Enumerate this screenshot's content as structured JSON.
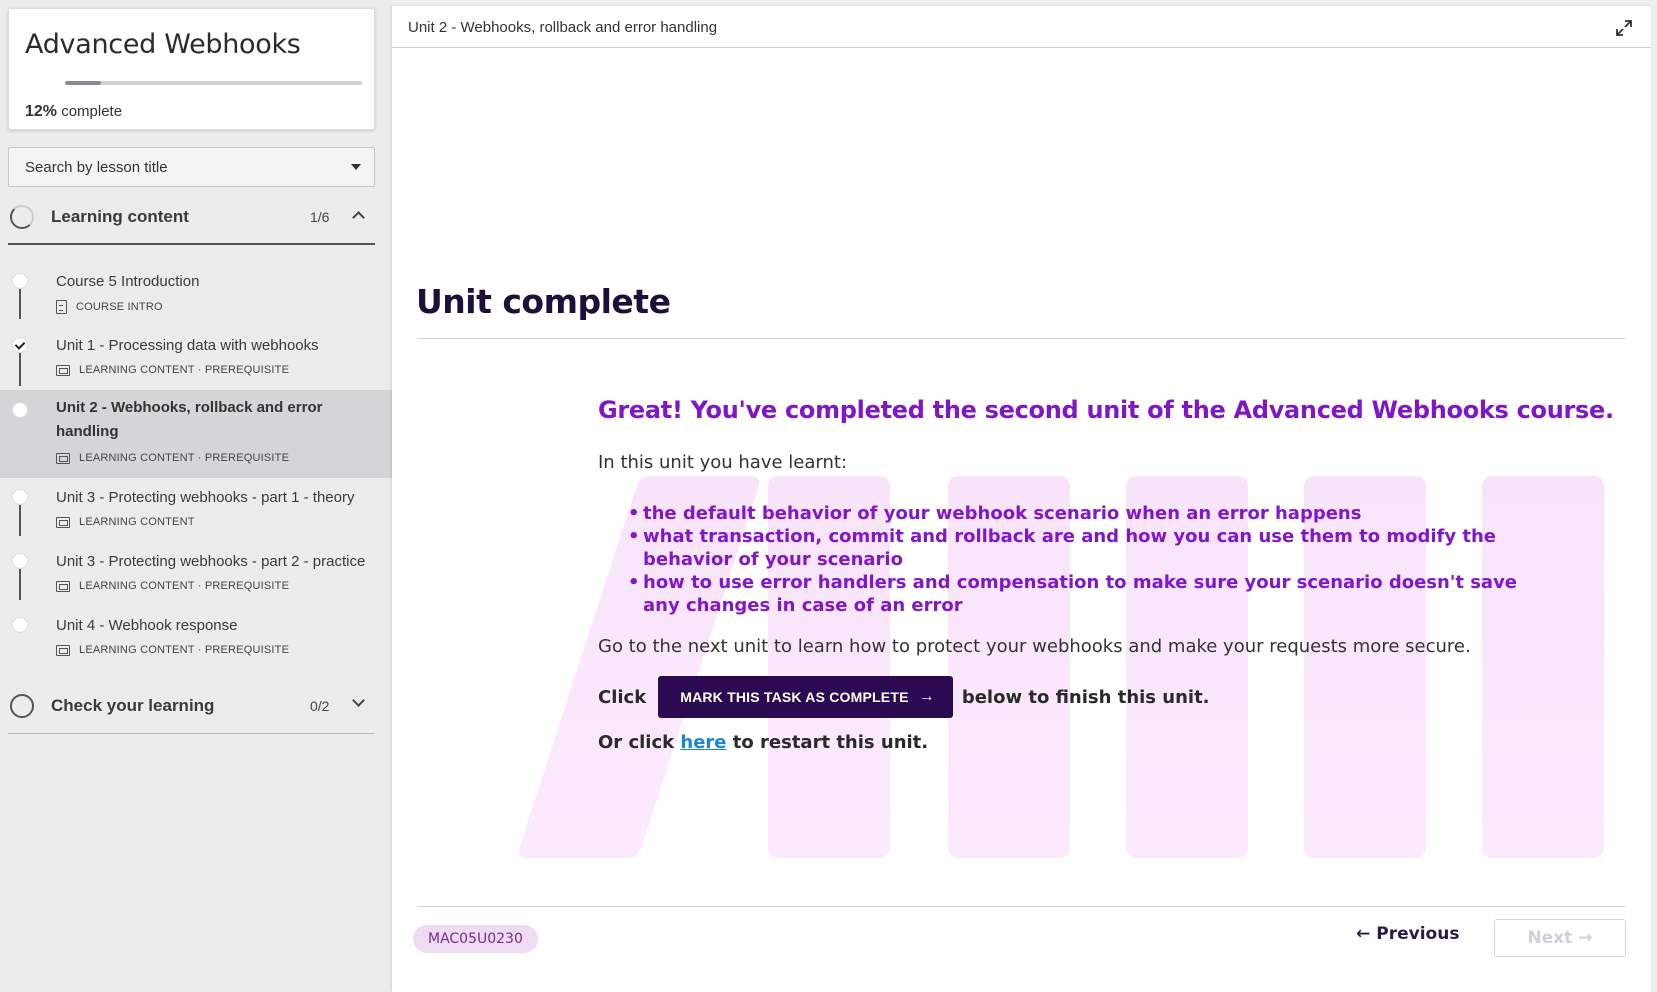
{
  "sidebar": {
    "course_title": "Advanced Webhooks",
    "progress_percent": "12%",
    "progress_value": 0.12,
    "progress_suffix": "complete",
    "search_placeholder": "Search by lesson title",
    "sections": [
      {
        "title": "Learning content",
        "count": "1/6",
        "expanded": true,
        "lessons": [
          {
            "title": "Course 5 Introduction",
            "meta": "COURSE INTRO",
            "completed": false,
            "active": false
          },
          {
            "title": "Unit 1 - Processing data with webhooks",
            "meta": "LEARNING CONTENT · PREREQUISITE",
            "completed": true,
            "active": false
          },
          {
            "title": "Unit 2 - Webhooks, rollback and error handling",
            "meta": "LEARNING CONTENT · PREREQUISITE",
            "completed": false,
            "active": true
          },
          {
            "title": "Unit 3 - Protecting webhooks - part 1 - theory",
            "meta": "LEARNING CONTENT",
            "completed": false,
            "active": false
          },
          {
            "title": "Unit 3 - Protecting webhooks - part 2 - practice",
            "meta": "LEARNING CONTENT · PREREQUISITE",
            "completed": false,
            "active": false
          },
          {
            "title": "Unit 4 - Webhook response",
            "meta": "LEARNING CONTENT · PREREQUISITE",
            "completed": false,
            "active": false
          }
        ]
      },
      {
        "title": "Check your learning",
        "count": "0/2",
        "expanded": false
      }
    ]
  },
  "main": {
    "topbar_title": "Unit 2 - Webhooks, rollback and error handling",
    "heading": "Unit complete",
    "great": "Great! You've completed the second unit of the Advanced Webhooks course.",
    "intro": "In this unit you have learnt:",
    "bullets": [
      "the default behavior of your webhook scenario when an error happens",
      "what transaction, commit and rollback are and how you can use them to modify the behavior of your scenario",
      "how to use error handlers and compensation to make sure your scenario doesn't save any changes in case of an error"
    ],
    "goto": "Go to the next unit to learn how to protect your webhooks and make your requests more secure.",
    "click_prefix": "Click",
    "mark_button": "MARK THIS TASK AS COMPLETE",
    "click_suffix": "below to finish this unit.",
    "restart_prefix": "Or click",
    "restart_link": "here",
    "restart_suffix": "to restart this unit.",
    "code": "MAC05U0230",
    "previous": "Previous",
    "next": "Next"
  },
  "colors": {
    "accent_purple": "#7f17c7",
    "button_dark": "#2c0a52",
    "link_blue": "#1a87d6",
    "badge_bg": "#eddcf2"
  }
}
